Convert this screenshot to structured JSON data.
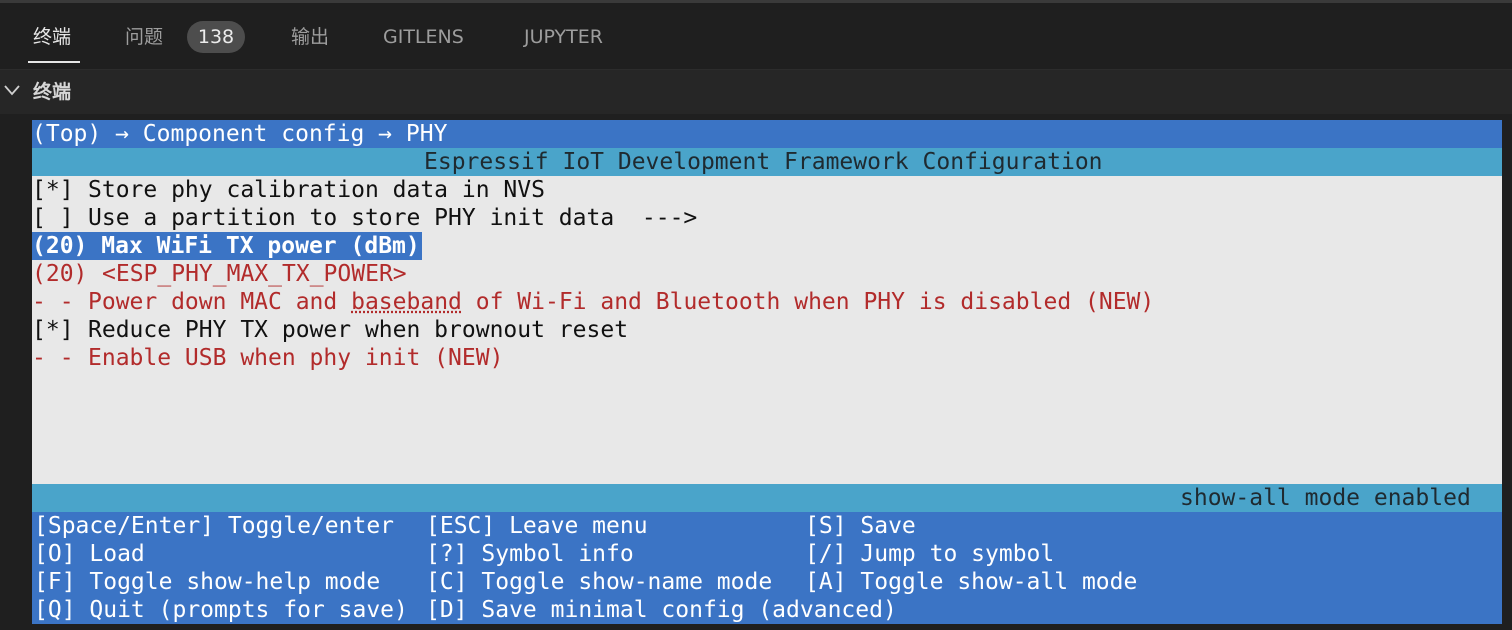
{
  "panel": {
    "tabs": [
      {
        "label": "终端",
        "active": true
      },
      {
        "label": "问题",
        "badge": "138"
      },
      {
        "label": "输出"
      },
      {
        "label": "GITLENS"
      },
      {
        "label": "JUPYTER"
      }
    ],
    "section_title": "终端"
  },
  "terminal": {
    "breadcrumb": "(Top) → Component config → PHY",
    "title": "Espressif IoT Development Framework Configuration",
    "items": [
      {
        "prefix": "[*]",
        "text": "Store phy calibration data in NVS"
      },
      {
        "prefix": "[ ]",
        "text": "Use a partition to store PHY init data  --->"
      },
      {
        "prefix": "(20)",
        "text": "Max WiFi TX power (dBm)",
        "selected": true
      },
      {
        "prefix": "(20)",
        "text": "<ESP_PHY_MAX_TX_POWER>",
        "dim": true
      },
      {
        "prefix": "- -",
        "text_a": "Power down MAC and ",
        "text_b": "baseband",
        "text_c": " of Wi-Fi and Bluetooth when PHY is disabled (NEW)",
        "dim": true
      },
      {
        "prefix": "[*]",
        "text": "Reduce PHY TX power when brownout reset"
      },
      {
        "prefix": "- -",
        "text": "Enable USB when phy init (NEW)",
        "dim": true
      }
    ],
    "status": "show-all mode enabled",
    "help": [
      [
        "[Space/Enter] Toggle/enter",
        "[ESC] Leave menu",
        "[S] Save"
      ],
      [
        "[O] Load",
        "[?] Symbol info",
        "[/] Jump to symbol"
      ],
      [
        "[F] Toggle show-help mode",
        "[C] Toggle show-name mode",
        "[A] Toggle show-all mode"
      ],
      [
        "[Q] Quit (prompts for save)",
        "[D] Save minimal config (advanced)",
        ""
      ]
    ]
  }
}
